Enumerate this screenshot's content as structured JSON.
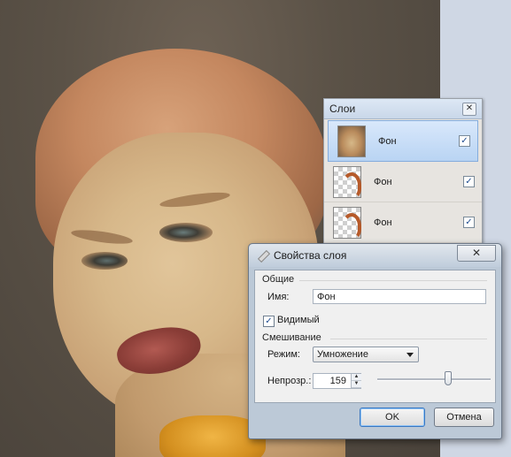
{
  "layers_panel": {
    "title": "Слои",
    "close_icon": "close-icon",
    "layers": [
      {
        "name": "Фон",
        "visible": true,
        "selected": true,
        "thumb": "photo"
      },
      {
        "name": "Фон",
        "visible": true,
        "selected": false,
        "thumb": "checker"
      },
      {
        "name": "Фон",
        "visible": true,
        "selected": false,
        "thumb": "checker"
      }
    ]
  },
  "dialog": {
    "title": "Свойства слоя",
    "close_label": "✕",
    "general_section": "Общие",
    "name_label": "Имя:",
    "name_value": "Фон",
    "visible_label": "Видимый",
    "visible_checked": true,
    "blend_section": "Смешивание",
    "mode_label": "Режим:",
    "mode_value": "Умножение",
    "opacity_label": "Непрозр.:",
    "opacity_value": "159",
    "ok_label": "OK",
    "cancel_label": "Отмена"
  },
  "colors": {
    "accent": "#3a78c2",
    "selection": "#b9d4f3"
  }
}
